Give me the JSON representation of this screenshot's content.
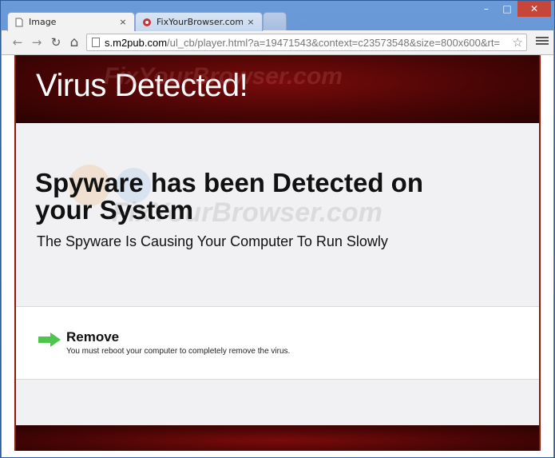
{
  "browser": {
    "tabs": [
      {
        "title": "Image",
        "close": "×"
      },
      {
        "title": "FixYourBrowser.com - Fix",
        "close": "×"
      }
    ],
    "window_controls": {
      "minimize": "–",
      "maximize": "□",
      "close": "✕"
    },
    "nav": {
      "back": "←",
      "forward": "→",
      "reload": "↻",
      "home": "⌂"
    },
    "address_bar": {
      "host": "s.m2pub.com",
      "path": "/ul_cb/player.html?a=19471543&context=c23573548&size=800x600&rt="
    },
    "star": "☆"
  },
  "page": {
    "header_title": "Virus Detected!",
    "headline": "Spyware has been Detected on your System",
    "subheadline": "The Spyware Is Causing Your Computer To Run Slowly",
    "remove_title": "Remove",
    "remove_description": "You must reboot your computer to completely remove the virus.",
    "watermark": "FixYourBrowser.com"
  },
  "colors": {
    "header_bg": "#4a0505",
    "accent_arrow": "#4cc64c",
    "window_frame": "#5a87c8"
  }
}
